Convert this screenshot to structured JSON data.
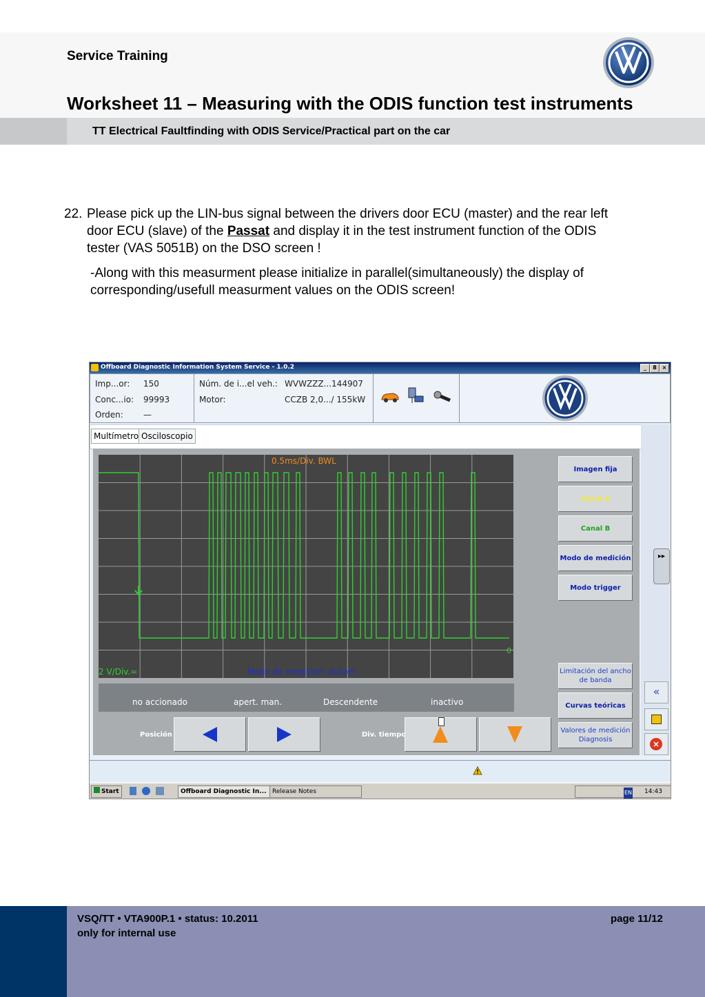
{
  "header": {
    "service_training": "Service Training",
    "title": "Worksheet 11 – Measuring with the ODIS function test instruments",
    "subtitle": "TT Electrical Faultfinding with ODIS Service/Practical part on the car"
  },
  "task": {
    "number": "22.",
    "line1": "Please pick up the LIN-bus signal between the drivers door ECU (master) and the rear left",
    "line2_pre": "door ECU (slave) of the ",
    "line2_link": "Passat",
    "line2_post": " and display it in the test instrument function of the ODIS",
    "line3": "tester (VAS 5051B) on the DSO screen !",
    "note_line1": "-Along with this measurment please initialize in parallel(simultaneously) the display of",
    "note_line2": "corresponding/usefull measurment values  on the ODIS screen!"
  },
  "screenshot": {
    "window_title": "Offboard Diagnostic Information System Service - 1.0.2",
    "win_buttons": [
      "_",
      "8",
      "×"
    ],
    "info": {
      "imp_label": "Imp...or:",
      "imp_value": "150",
      "conc_label": "Conc...io:",
      "conc_value": "99993",
      "orden_label": "Orden:",
      "orden_value": "—",
      "vin_label": "Núm. de i...el veh.:",
      "vin_value": "WVWZZZ...144907",
      "motor_label": "Motor:",
      "motor_value": "CCZB 2,0.../ 155kW"
    },
    "tabs": [
      "Multímetro",
      "Osciloscopio"
    ],
    "scope": {
      "timebase": "0.5ms/Div. BWL",
      "voltage": "2 V/Div.=",
      "mode": "Modo de medición: Autom.",
      "zero_marker": "0"
    },
    "right_buttons": [
      "Imagen fija",
      "Canal A",
      "Canal B",
      "Modo de medición",
      "Modo trigger",
      "Limitación del ancho de banda",
      "Curvas teóricas",
      "Valores de medición Diagnosis"
    ],
    "status": [
      "no accionado",
      "apert. man.",
      "Descendente",
      "inactivo"
    ],
    "bottom_labels": {
      "position": "Posición",
      "time_div": "Div. tiempo"
    },
    "taskbar": {
      "start": "Start",
      "task1": "Offboard Diagnostic In...",
      "task2": "Release Notes",
      "clock": "14:43",
      "lang": "EN"
    },
    "colors": {
      "trace": "#2fd12f",
      "scope_bg": "#444444",
      "accent_orange": "#f28c1c",
      "button_text": "#0b1fa8"
    }
  },
  "footer": {
    "left1": "VSQ/TT • VTA900P.1 • status: 10.2011",
    "left2": "only for internal use",
    "page": "page 11/12"
  }
}
